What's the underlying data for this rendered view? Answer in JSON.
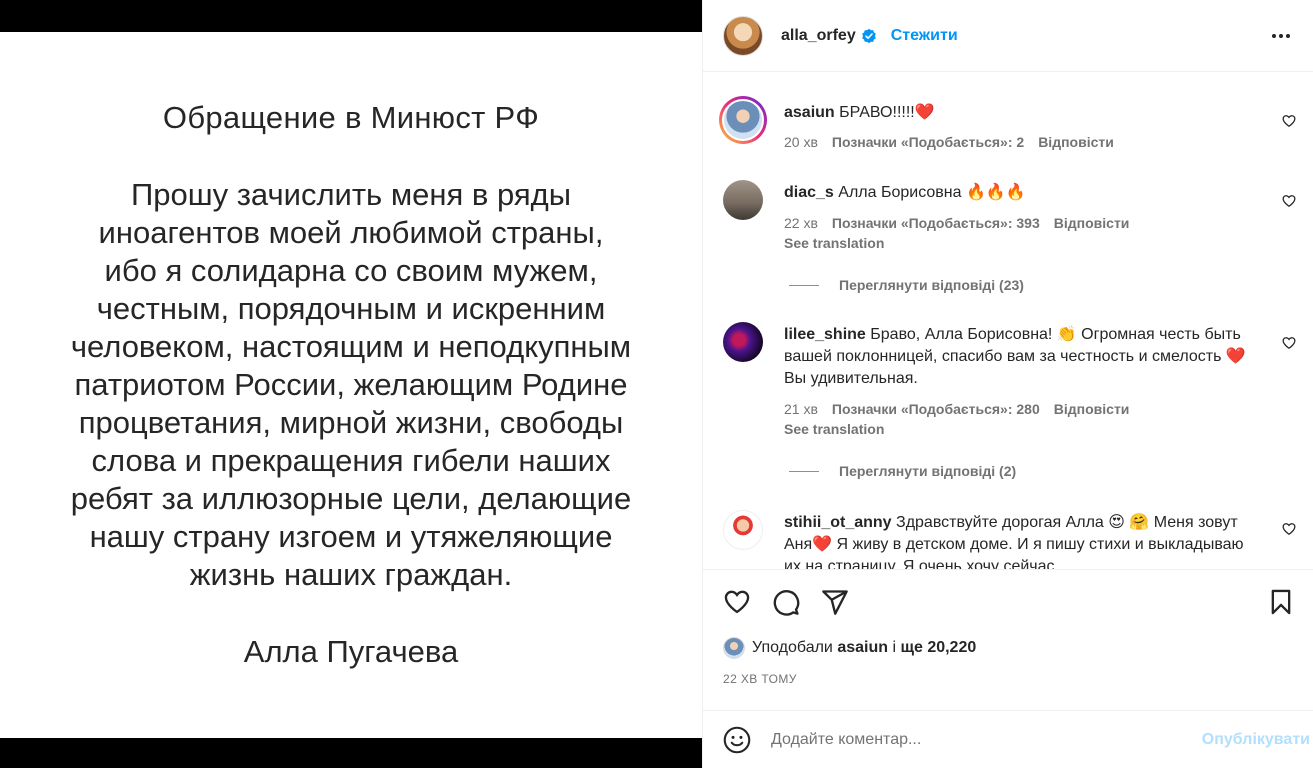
{
  "post_image": {
    "title": "Обращение в Минюст РФ",
    "body_lines": [
      "Прошу зачислить меня в ряды",
      "иноагентов моей любимой страны,",
      "ибо я солидарна со своим мужем,",
      "честным, порядочным и искренним",
      "человеком, настоящим и неподкупным",
      "патриотом России, желающим Родине",
      "процветания, мирной жизни, свободы",
      "слова и прекращения гибели наших",
      "ребят за иллюзорные цели, делающие",
      "нашу страну изгоем и утяжеляющие",
      "жизнь наших граждан."
    ],
    "signature": "Алла Пугачева"
  },
  "header": {
    "username": "alla_orfey",
    "verified_icon": "verified-badge-icon",
    "follow_label": "Стежити",
    "more_icon": "more-options-icon"
  },
  "comments": [
    {
      "username": "asaiun",
      "text": "БРАВО!!!!!❤️",
      "time": "20 хв",
      "likes_label": "Позначки «Подобається»: 2",
      "reply_label": "Відповісти"
    },
    {
      "username": "diac_s",
      "text": "Алла Борисовна 🔥🔥🔥",
      "time": "22 хв",
      "likes_label": "Позначки «Подобається»: 393",
      "reply_label": "Відповісти",
      "translate_label": "See translation",
      "view_replies_label": "Переглянути відповіді (23)"
    },
    {
      "username": "lilee_shine",
      "text": "Браво, Алла Борисовна! 👏 Огромная честь быть вашей поклонницей, спасибо вам за честность и смелость ❤️ Вы удивительная.",
      "time": "21 хв",
      "likes_label": "Позначки «Подобається»: 280",
      "reply_label": "Відповісти",
      "translate_label": "See translation",
      "view_replies_label": "Переглянути відповіді (2)"
    },
    {
      "username": "stihii_ot_anny",
      "text": "Здравствуйте дорогая Алла 😍 🤗 Меня зовут Аня❤️ Я живу в детском доме. И я пишу стихи и выкладываю их на страницу. Я очень хочу сейчас"
    }
  ],
  "actions": {
    "like_icon": "heart-outline-icon",
    "comment_icon": "comment-bubble-icon",
    "share_icon": "paper-plane-icon",
    "save_icon": "bookmark-icon"
  },
  "likes_summary": {
    "prefix": "Уподобали",
    "user": "asaiun",
    "middle": "і",
    "rest": "ще 20,220"
  },
  "timestamp": "22 хв тому",
  "add_comment": {
    "emoji_icon": "emoji-smile-icon",
    "placeholder": "Додайте коментар...",
    "post_label": "Опублікувати"
  },
  "colors": {
    "link_blue": "#0095f6",
    "post_disabled": "#b2dffc",
    "muted_text": "#737373"
  }
}
